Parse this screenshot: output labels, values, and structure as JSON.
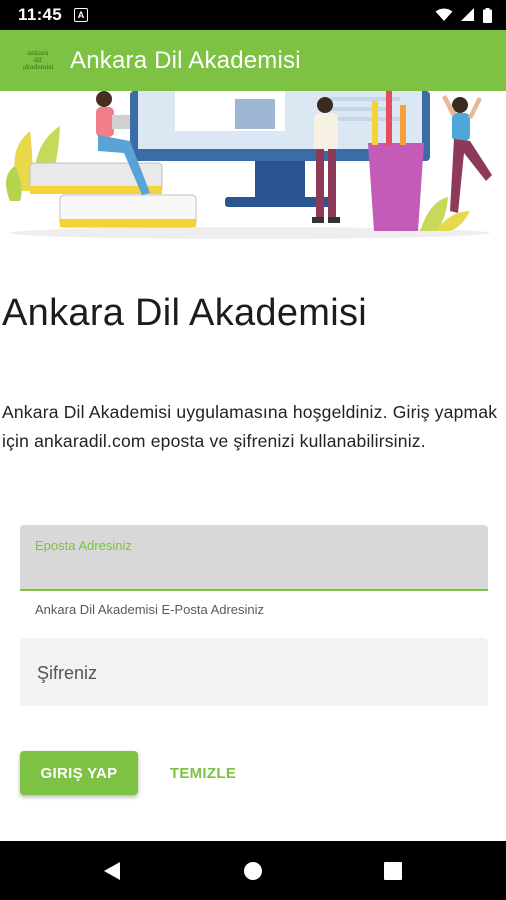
{
  "status_bar": {
    "time": "11:45",
    "notification_badge": "A",
    "icons": [
      "wifi-icon",
      "signal-icon",
      "battery-icon"
    ]
  },
  "app_bar": {
    "logo_lines": [
      "ankara",
      "dil",
      "akademisi"
    ],
    "title": "Ankara Dil Akademisi"
  },
  "banner": {
    "icon": "banner-illustration"
  },
  "main": {
    "title": "Ankara Dil Akademisi",
    "welcome_text": "Ankara Dil Akademisi uygulamasına hoşgeldiniz. Giriş yapmak için ankaradil.com eposta ve şifrenizi kullanabilirsiniz.",
    "email": {
      "label": "Eposta Adresiniz",
      "value": "",
      "helper": "Ankara Dil Akademisi E-Posta Adresiniz"
    },
    "password": {
      "placeholder": "Şifreniz",
      "value": ""
    },
    "login_label": "GIRIŞ YAP",
    "clear_label": "TEMIZLE"
  },
  "nav_bar": {
    "icons": [
      "back-icon",
      "home-icon",
      "recents-icon"
    ]
  },
  "colors": {
    "accent": "#7dc242",
    "status_bar": "#000000",
    "field_active_bg": "#d8d8d8",
    "field_bg": "#f3f3f3"
  }
}
